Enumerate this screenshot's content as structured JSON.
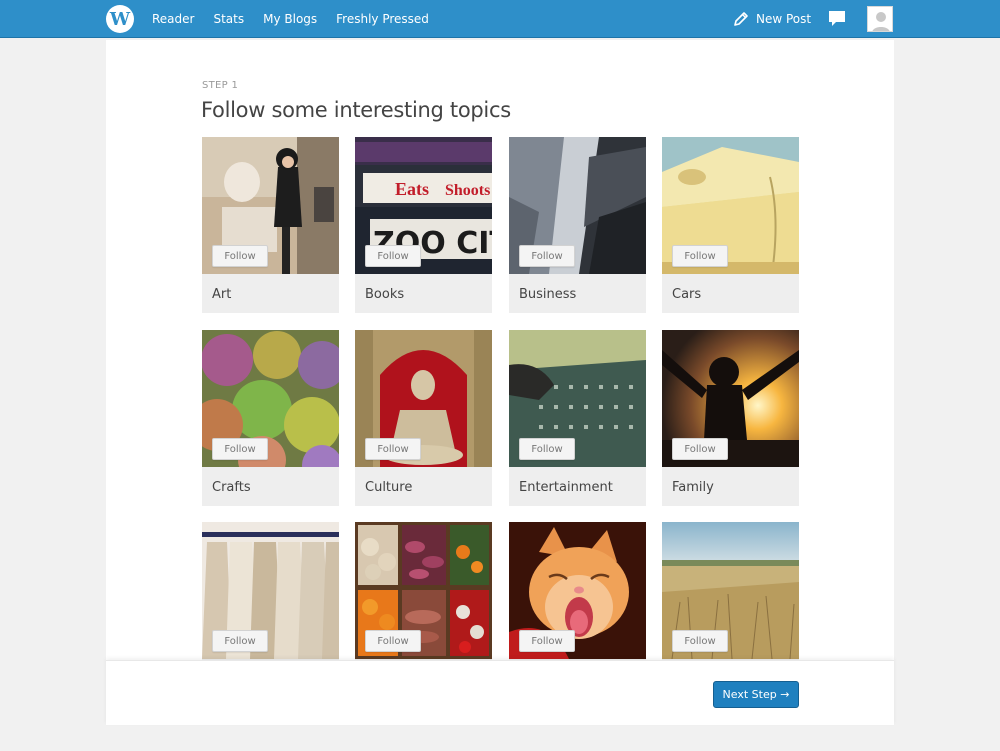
{
  "topbar": {
    "nav": [
      "Reader",
      "Stats",
      "My Blogs",
      "Freshly Pressed"
    ],
    "new_post_label": "New Post",
    "icons": {
      "logo": "wordpress-logo-icon",
      "new_post": "pencil-icon",
      "notifications": "comment-icon",
      "avatar": "avatar-icon"
    },
    "accent_color": "#2e8fc9"
  },
  "main": {
    "step_label": "STEP 1",
    "title": "Follow some interesting topics",
    "follow_label": "Follow",
    "topics": [
      "Art",
      "Books",
      "Business",
      "Cars",
      "Crafts",
      "Culture",
      "Entertainment",
      "Family",
      "",
      "",
      "",
      ""
    ]
  },
  "footer": {
    "next_label": "Next Step →",
    "button_color": "#1f80bf"
  }
}
